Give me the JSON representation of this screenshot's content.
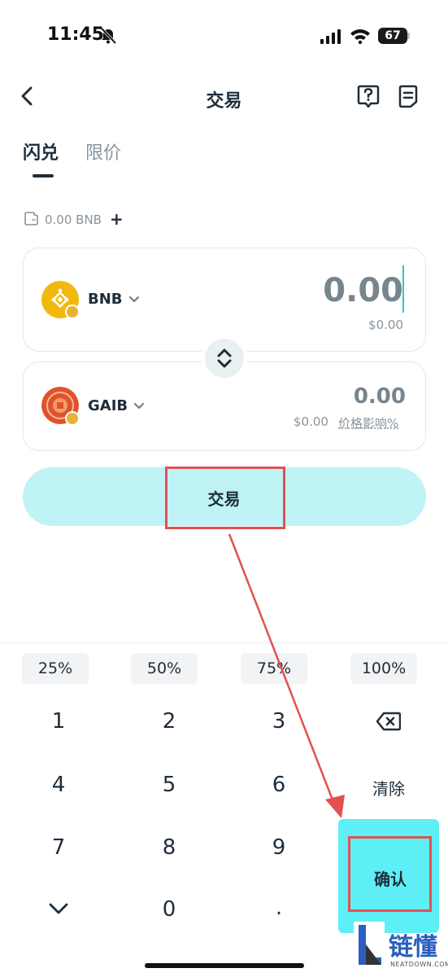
{
  "status_bar": {
    "time": "11:45",
    "battery": "67"
  },
  "header": {
    "title": "交易"
  },
  "tabs": [
    {
      "label": "闪兑"
    },
    {
      "label": "限价"
    }
  ],
  "balance": {
    "text": "0.00 BNB",
    "add": "+"
  },
  "from": {
    "symbol": "BNB",
    "amount": "0.00",
    "usd": "$0.00"
  },
  "to": {
    "symbol": "GAIB",
    "amount": "0.00",
    "usd": "$0.00",
    "impact_label": "价格影响%"
  },
  "trade_button": {
    "label": "交易"
  },
  "percent_buttons": [
    "25%",
    "50%",
    "75%",
    "100%"
  ],
  "keypad": {
    "k1": "1",
    "k2": "2",
    "k3": "3",
    "k4": "4",
    "k5": "5",
    "k6": "6",
    "k7": "7",
    "k8": "8",
    "k9": "9",
    "k0": "0",
    "dot": ".",
    "clear": "清除",
    "confirm": "确认"
  },
  "watermark": {
    "text": "链懂",
    "sub": "NEATDOWN.COM"
  },
  "colors": {
    "accent": "#5eeff6",
    "trade_bg": "#bff3f6",
    "highlight": "#e25050",
    "bnb": "#f0b90b",
    "gaib": "#e0532a"
  },
  "icons": [
    "bell-slash-icon",
    "signal-icon",
    "wifi-icon",
    "back-icon",
    "help-icon",
    "orders-icon",
    "wallet-icon",
    "swap-icon",
    "backspace-icon",
    "chevron-down-icon"
  ]
}
